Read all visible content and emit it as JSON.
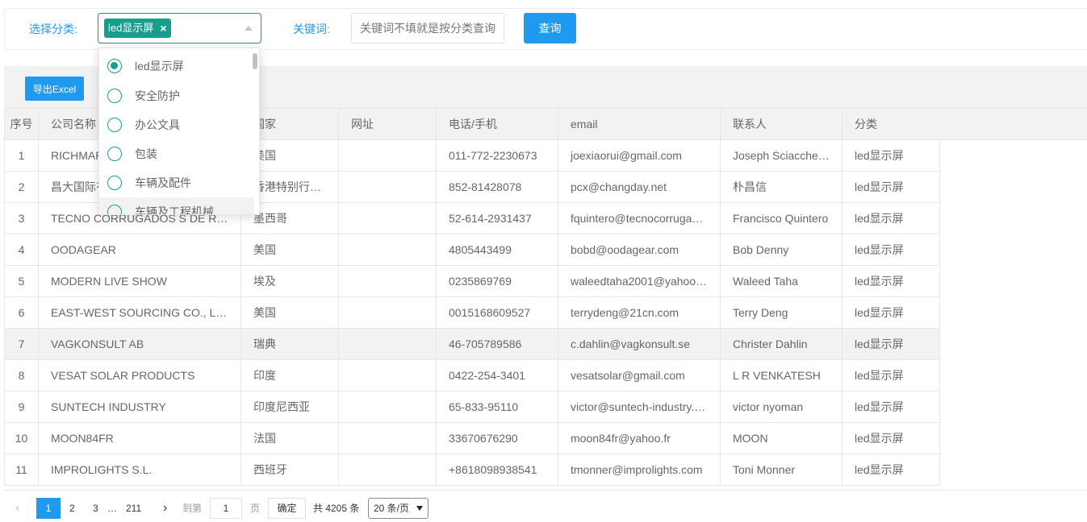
{
  "filters": {
    "category_label": "选择分类:",
    "selected_tag": "led显示屏",
    "tag_close": "×",
    "keyword_label": "关键词:",
    "keyword_placeholder": "关键词不填就是按分类查询",
    "query_button": "查询"
  },
  "toolbar": {
    "export_button": "导出Excel"
  },
  "dropdown": {
    "options": [
      {
        "label": "led显示屏",
        "selected": true
      },
      {
        "label": "安全防护",
        "selected": false
      },
      {
        "label": "办公文具",
        "selected": false
      },
      {
        "label": "包装",
        "selected": false
      },
      {
        "label": "车辆及配件",
        "selected": false
      },
      {
        "label": "车辆及工程机械",
        "selected": false
      }
    ]
  },
  "table": {
    "headers": [
      "序号",
      "公司名称",
      "国家",
      "网址",
      "电话/手机",
      "email",
      "联系人",
      "分类"
    ],
    "rows": [
      [
        "1",
        "RICHMAR",
        "美国",
        "",
        "011-772-2230673",
        "joexiaorui@gmail.com",
        "Joseph Sciacche…",
        "led显示屏"
      ],
      [
        "2",
        "昌大国际有",
        "香港特别行…",
        "",
        "852-81428078",
        "pcx@changday.net",
        "朴昌信",
        "led显示屏"
      ],
      [
        "3",
        "TECNO CORRUGADOS S DE R…",
        "墨西哥",
        "",
        "52-614-2931437",
        "fquintero@tecnocorruga…",
        "Francisco Quintero",
        "led显示屏"
      ],
      [
        "4",
        "OODAGEAR",
        "美国",
        "",
        "4805443499",
        "bobd@oodagear.com",
        "Bob Denny",
        "led显示屏"
      ],
      [
        "5",
        "MODERN LIVE SHOW",
        "埃及",
        "",
        "0235869769",
        "waleedtaha2001@yahoo…",
        "Waleed Taha",
        "led显示屏"
      ],
      [
        "6",
        "EAST-WEST SOURCING CO., L…",
        "美国",
        "",
        "0015168609527",
        "terrydeng@21cn.com",
        "Terry Deng",
        "led显示屏"
      ],
      [
        "7",
        "VAGKONSULT AB",
        "瑞典",
        "",
        "46-705789586",
        "c.dahlin@vagkonsult.se",
        "Christer Dahlin",
        "led显示屏"
      ],
      [
        "8",
        "VESAT SOLAR PRODUCTS",
        "印度",
        "",
        "0422-254-3401",
        "vesatsolar@gmail.com",
        "L R VENKATESH",
        "led显示屏"
      ],
      [
        "9",
        "SUNTECH INDUSTRY",
        "印度尼西亚",
        "",
        "65-833-95110",
        "victor@suntech-industry.…",
        "victor nyoman",
        "led显示屏"
      ],
      [
        "10",
        "MOON84FR",
        "法国",
        "",
        "33670676290",
        "moon84fr@yahoo.fr",
        "MOON",
        "led显示屏"
      ],
      [
        "11",
        "IMPROLIGHTS S.L.",
        "西班牙",
        "",
        "+8618098938541",
        "tmonner@improlights.com",
        "Toni Monner",
        "led显示屏"
      ]
    ]
  },
  "pager": {
    "prev": "‹",
    "pages": [
      "1",
      "2",
      "3"
    ],
    "ellipsis": "…",
    "last_page": "211",
    "next": "›",
    "goto_label": "到第",
    "goto_value": "1",
    "page_unit": "页",
    "confirm": "确定",
    "total": "共 4205 条",
    "page_size": "20 条/页"
  }
}
